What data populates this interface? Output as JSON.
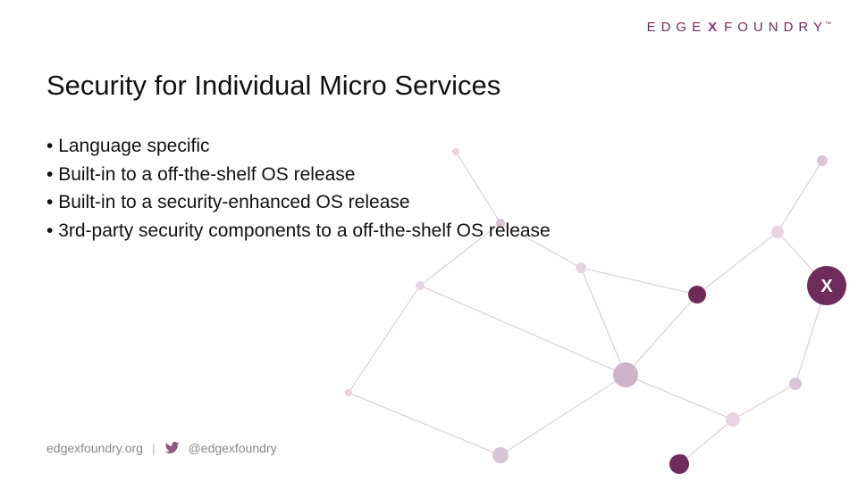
{
  "brand": {
    "edge": "EDGE",
    "x": "X",
    "foundry": "FOUNDRY",
    "tm": "™"
  },
  "title": "Security for Individual Micro Services",
  "bullets": [
    "Language specific",
    "Built-in to a off-the-shelf OS release",
    "Built-in to a security-enhanced OS release",
    "3rd-party security components to a off-the-shelf OS release"
  ],
  "footer": {
    "site": "edgexfoundry.org",
    "separator": "|",
    "handle": "@edgexfoundry"
  },
  "colors": {
    "accent": "#6f2c5a",
    "node_light": "#e6d4e1",
    "node_mid": "#bfa5b9"
  }
}
